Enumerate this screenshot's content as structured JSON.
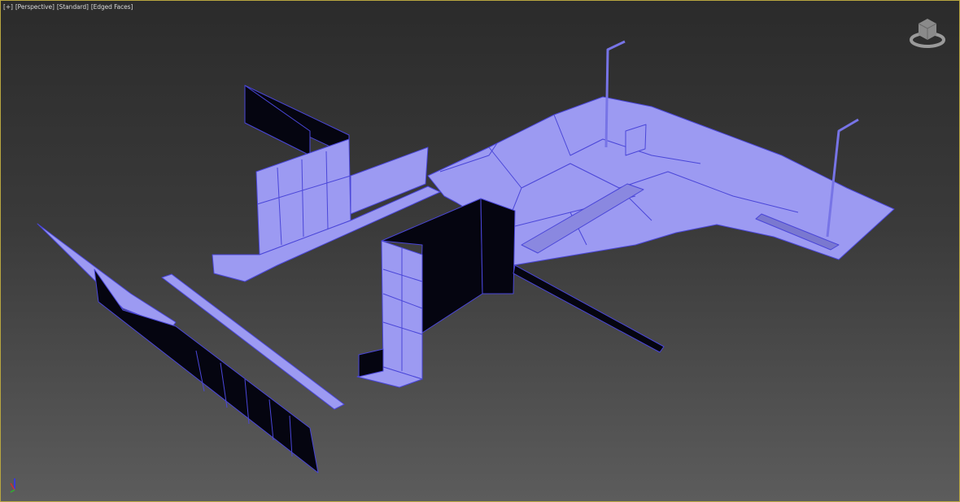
{
  "viewport": {
    "labels": [
      "[+]",
      "[Perspective]",
      "[Standard]",
      "[Edged Faces]"
    ],
    "active_border_color": "#b8a640"
  },
  "colors": {
    "face": "#9c9af2",
    "edge": "#4a46d8",
    "dark_face": "#050510"
  },
  "icons": {
    "viewcube": "viewcube-icon",
    "axis": "axis-tripod-icon"
  }
}
